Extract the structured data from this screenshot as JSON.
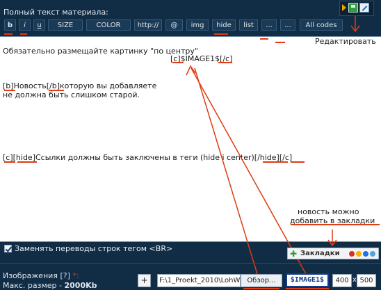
{
  "header": {
    "full_text_label": "Полный текст материала:"
  },
  "toolbar": {
    "buttons": [
      "b",
      "i",
      "u",
      "SIZE",
      "COLOR",
      "http://",
      "@",
      "img",
      "hide",
      "list",
      "...",
      "...",
      "All codes"
    ]
  },
  "editor": {
    "line1": "Обязательно размещайте картинку \"по центру\"",
    "line2": "[c]$IMAGE1$[/c]",
    "line3": "[b]Новость[/b]которую вы добавляете",
    "line4": "не должна быть слишком старой.",
    "line5": "[c][hide]Ссылки должны быть заключены в теги (hide i center)[/hide][/c]",
    "edit_note": "Редактировать",
    "bookmarks_note_1": "новость можно",
    "bookmarks_note_2": "добавить в закладки"
  },
  "options": {
    "replace_breaks_label": "Заменять переводы строк тегом <BR>",
    "bookmarks_button": "Закладки",
    "bookmark_colors": [
      "#d93025",
      "#f4b400",
      "#1a73e8",
      "#4ea6dc"
    ]
  },
  "images": {
    "label": "Изображения",
    "help": "[?]",
    "star": "*:",
    "max_size_prefix": "Макс. размер - ",
    "max_size_value": "2000Kb",
    "add_label": "+",
    "file_path": "F:\\1_Proekt_2010\\LohW",
    "browse_label": "Обзор...",
    "image_tag": "$IMAGE1$",
    "width": "400",
    "x": "x",
    "height": "500"
  },
  "colors": {
    "background": "#112d46",
    "accent_red": "#e03b12",
    "tag_blue": "#0f3a8a"
  }
}
